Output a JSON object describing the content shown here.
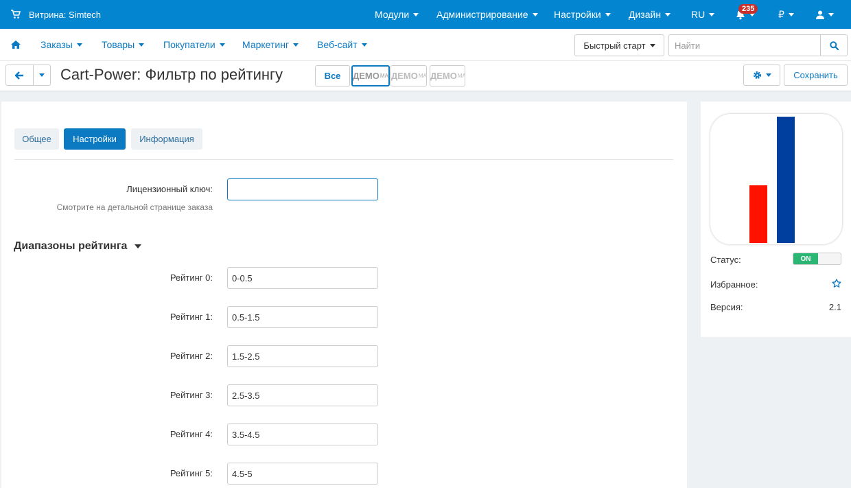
{
  "topbar": {
    "store": "Витрина: Simtech",
    "menu": [
      "Модули",
      "Администрирование",
      "Настройки",
      "Дизайн",
      "RU"
    ],
    "notifications_count": "235",
    "currency": "₽"
  },
  "navbar": {
    "items": [
      "Заказы",
      "Товары",
      "Покупатели",
      "Маркетинг",
      "Веб-сайт"
    ],
    "quick_start": "Быстрый старт",
    "search_placeholder": "Найти"
  },
  "titlebar": {
    "title": "Cart-Power: Фильтр по рейтингу",
    "all_label": "Все",
    "demo_label": "ДЕМО",
    "demo_sup": "MA",
    "save_label": "Сохранить"
  },
  "tabs": [
    "Общее",
    "Настройки",
    "Информация"
  ],
  "license": {
    "label": "Лицензионный ключ:",
    "value": "",
    "hint": "Смотрите на детальной странице заказа"
  },
  "ranges": {
    "title": "Диапазоны рейтинга",
    "rows": [
      {
        "label": "Рейтинг 0:",
        "value": "0-0.5"
      },
      {
        "label": "Рейтинг 1:",
        "value": "0.5-1.5"
      },
      {
        "label": "Рейтинг 2:",
        "value": "1.5-2.5"
      },
      {
        "label": "Рейтинг 3:",
        "value": "2.5-3.5"
      },
      {
        "label": "Рейтинг 4:",
        "value": "3.5-4.5"
      },
      {
        "label": "Рейтинг 5:",
        "value": "4.5-5"
      }
    ]
  },
  "sidebar": {
    "status_label": "Статус:",
    "status_value": "ON",
    "favorite_label": "Избранное:",
    "version_label": "Версия:",
    "version_value": "2.1"
  },
  "colors": {
    "topbar": "#0385d0",
    "accent": "#0b7ac3",
    "toggle_on": "#2bb673",
    "logo_red": "#ff1200",
    "logo_blue": "#003f9e"
  }
}
